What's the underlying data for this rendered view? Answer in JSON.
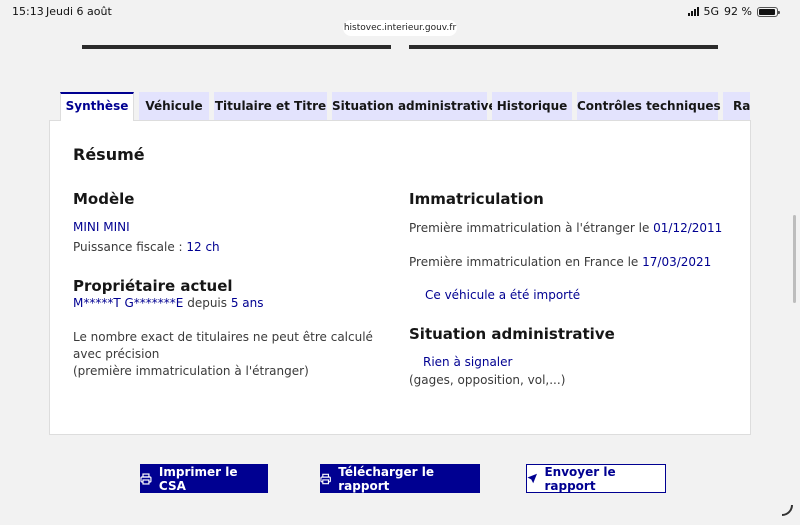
{
  "status_bar": {
    "time": "15:13",
    "date": "Jeudi 6 août",
    "network": "5G",
    "battery": "92 %",
    "battery_level": 0.92
  },
  "browser": {
    "url": "histovec.interieur.gouv.fr"
  },
  "tabs": [
    {
      "label": "Synthèse",
      "active": true
    },
    {
      "label": "Véhicule"
    },
    {
      "label": "Titulaire et Titre"
    },
    {
      "label": "Situation administrative"
    },
    {
      "label": "Historique"
    },
    {
      "label": "Contrôles techniques"
    },
    {
      "label": "Rapport"
    }
  ],
  "summary": {
    "title": "Résumé",
    "modele": {
      "heading": "Modèle",
      "value": "MINI MINI",
      "puissance_label": "Puissance fiscale : ",
      "puissance_value": "12 ch"
    },
    "proprietaire": {
      "heading": "Propriétaire actuel",
      "name": "M*****T G*******E",
      "depuis_label": " depuis ",
      "depuis_value": "5 ans",
      "note_line1": "Le nombre exact de titulaires ne peut être calculé avec précision",
      "note_line2": "(première immatriculation à l'étranger)"
    },
    "immatriculation": {
      "heading": "Immatriculation",
      "etranger_label": "Première immatriculation à l'étranger le ",
      "etranger_date": "01/12/2011",
      "france_label": "Première immatriculation en France le ",
      "france_date": "17/03/2021",
      "importe": "Ce véhicule a été importé"
    },
    "situation": {
      "heading": "Situation administrative",
      "status": "Rien à signaler",
      "details": "(gages, opposition, vol,...)"
    }
  },
  "actions": {
    "print": "Imprimer le CSA",
    "download": "Télécharger le rapport",
    "send": "Envoyer le rapport"
  },
  "colors": {
    "primary": "#000091",
    "tab_bg": "#e3e3fd"
  }
}
